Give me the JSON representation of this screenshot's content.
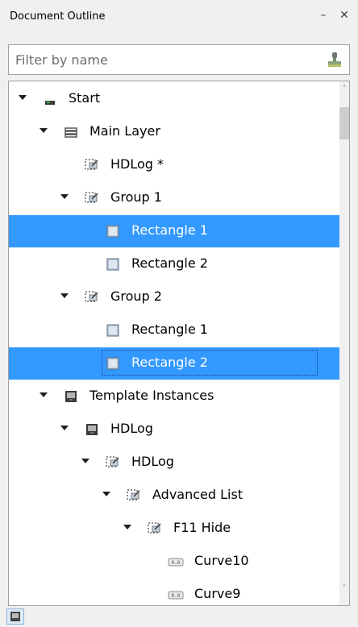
{
  "panel": {
    "title": "Document Outline",
    "pin_glyph": "–",
    "close_glyph": "✕"
  },
  "filter": {
    "placeholder": "Filter by name",
    "value": "",
    "icon": "stamp-icon"
  },
  "tree": {
    "nodes": [
      {
        "label": "Start",
        "depth": 0,
        "expander": "expanded",
        "icon": "start-icon",
        "selected": false
      },
      {
        "label": "Main Layer",
        "depth": 1,
        "expander": "expanded",
        "icon": "layer-icon",
        "selected": false
      },
      {
        "label": "HDLog *",
        "depth": 2,
        "expander": "none",
        "icon": "group-icon",
        "selected": false
      },
      {
        "label": "Group 1",
        "depth": 2,
        "expander": "expanded",
        "icon": "group-icon",
        "selected": false
      },
      {
        "label": "Rectangle 1",
        "depth": 3,
        "expander": "none",
        "icon": "rectangle-icon",
        "selected": true
      },
      {
        "label": "Rectangle 2",
        "depth": 3,
        "expander": "none",
        "icon": "rectangle-icon",
        "selected": false
      },
      {
        "label": "Group 2",
        "depth": 2,
        "expander": "expanded",
        "icon": "group-icon",
        "selected": false
      },
      {
        "label": "Rectangle 1",
        "depth": 3,
        "expander": "none",
        "icon": "rectangle-icon",
        "selected": false
      },
      {
        "label": "Rectangle 2",
        "depth": 3,
        "expander": "none",
        "icon": "rectangle-icon",
        "selected": true,
        "focused": true
      },
      {
        "label": "Template Instances",
        "depth": 1,
        "expander": "expanded",
        "icon": "template-icon",
        "selected": false
      },
      {
        "label": "HDLog",
        "depth": 2,
        "expander": "expanded",
        "icon": "template-icon",
        "selected": false
      },
      {
        "label": "HDLog",
        "depth": 3,
        "expander": "expanded",
        "icon": "group-icon",
        "selected": false
      },
      {
        "label": "Advanced List",
        "depth": 4,
        "expander": "expanded",
        "icon": "group-icon",
        "selected": false
      },
      {
        "label": "F11 Hide",
        "depth": 5,
        "expander": "expanded",
        "icon": "group-icon",
        "selected": false
      },
      {
        "label": "Curve10",
        "depth": 6,
        "expander": "none",
        "icon": "curve-icon",
        "selected": false
      },
      {
        "label": "Curve9",
        "depth": 6,
        "expander": "none",
        "icon": "curve-icon",
        "selected": false
      }
    ]
  },
  "scrollbar": {
    "up_glyph": "˄",
    "down_glyph": "˅",
    "position": 0.0
  },
  "statusbar": {
    "button_icon": "template-icon"
  },
  "colors": {
    "selection": "#3399ff",
    "background": "#f0f0f0",
    "tree_background": "#ffffff"
  }
}
